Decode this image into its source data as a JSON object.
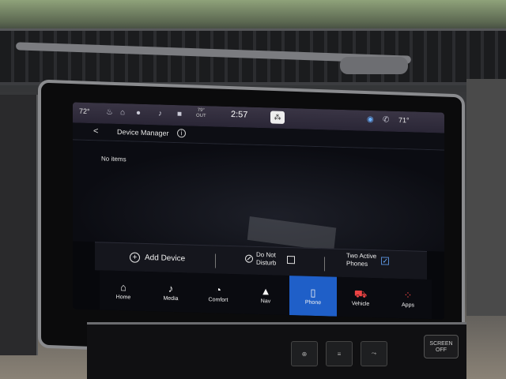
{
  "statusbar": {
    "cabin_temp": "72°",
    "outside_temp": "79°",
    "outside_label": "OUT",
    "clock": "2:57",
    "right_temp": "71°"
  },
  "header": {
    "back": "<",
    "title": "Device Manager",
    "info": "i"
  },
  "content": {
    "empty_text": "No items"
  },
  "actions": {
    "add_device": "Add Device",
    "do_not_disturb_line1": "Do Not",
    "do_not_disturb_line2": "Disturb",
    "two_active_line1": "Two Active",
    "two_active_line2": "Phones"
  },
  "nav": [
    {
      "label": "Home",
      "icon": "home-icon"
    },
    {
      "label": "Media",
      "icon": "music-icon"
    },
    {
      "label": "Comfort",
      "icon": "comfort-icon"
    },
    {
      "label": "Nav",
      "icon": "compass-icon"
    },
    {
      "label": "Phone",
      "icon": "phone-icon",
      "active": true
    },
    {
      "label": "Vehicle",
      "icon": "vehicle-icon"
    },
    {
      "label": "Apps",
      "icon": "apps-grid-icon"
    }
  ],
  "hardware": {
    "screen_off_line1": "SCREEN",
    "screen_off_line2": "OFF"
  },
  "colors": {
    "active_tab": "#1f5fc8",
    "statusbar": "#2f2b3c"
  }
}
